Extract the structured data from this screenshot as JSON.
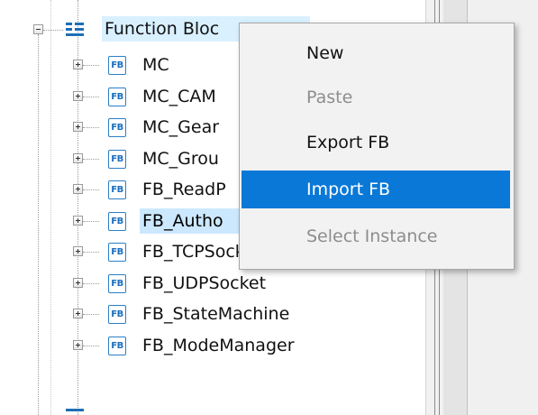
{
  "tree": {
    "root": {
      "label": "Function Bloc"
    },
    "icon_text": "FB",
    "items": [
      {
        "label": "MC"
      },
      {
        "label": "MC_CAM"
      },
      {
        "label": "MC_Gear"
      },
      {
        "label": "MC_Grou"
      },
      {
        "label": "FB_ReadP"
      },
      {
        "label": "FB_Autho"
      },
      {
        "label": "FB_TCPSocket"
      },
      {
        "label": "FB_UDPSocket"
      },
      {
        "label": "FB_StateMachine"
      },
      {
        "label": "FB_ModeManager"
      }
    ]
  },
  "context_menu": {
    "items": [
      {
        "label": "New",
        "enabled": true
      },
      {
        "label": "Paste",
        "enabled": false
      },
      {
        "label": "Export FB",
        "enabled": true
      },
      {
        "label": "Import FB",
        "enabled": true,
        "highlighted": true
      },
      {
        "label": "Select Instance",
        "enabled": false
      }
    ]
  },
  "colors": {
    "selection": "#cce8ff",
    "menu_highlight": "#0a78d7",
    "fb_icon": "#2a7fc8",
    "disabled_text": "#8d8d8d"
  }
}
